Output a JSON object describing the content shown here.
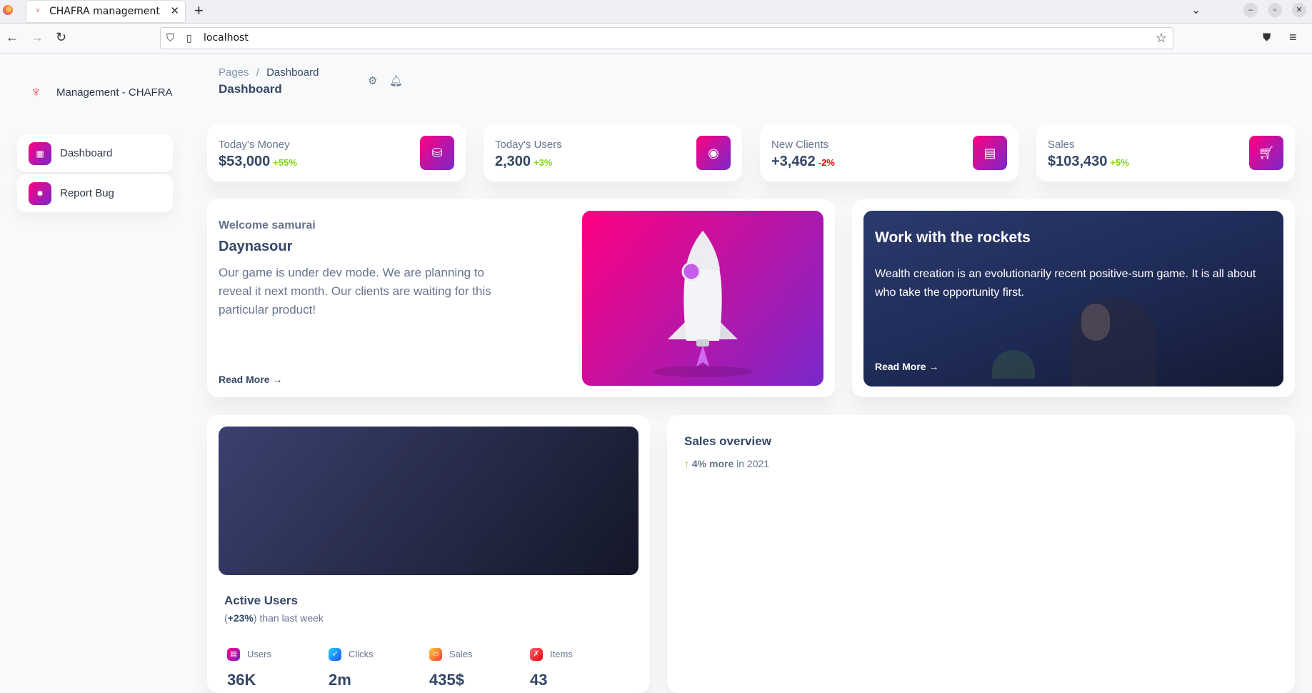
{
  "browser": {
    "tab_title": "CHAFRA management",
    "url": "localhost"
  },
  "sidebar": {
    "brand": "Management - CHAFRA",
    "items": [
      {
        "label": "Dashboard",
        "icon": "shop-icon"
      },
      {
        "label": "Report Bug",
        "icon": "bug-icon"
      }
    ]
  },
  "header": {
    "breadcrumb_root": "Pages",
    "breadcrumb_sep": "/",
    "breadcrumb_current": "Dashboard",
    "title": "Dashboard"
  },
  "stats": [
    {
      "label": "Today's Money",
      "value": "$53,000",
      "change": "+55%",
      "trend": "up",
      "icon": "money-icon"
    },
    {
      "label": "Today's Users",
      "value": "2,300",
      "change": "+3%",
      "trend": "up",
      "icon": "globe-icon"
    },
    {
      "label": "New Clients",
      "value": "+3,462",
      "change": "-2%",
      "trend": "down",
      "icon": "document-icon"
    },
    {
      "label": "Sales",
      "value": "$103,430",
      "change": "+5%",
      "trend": "up",
      "icon": "cart-icon"
    }
  ],
  "welcome": {
    "subtitle": "Welcome samurai",
    "title": "Daynasour",
    "text": "Our game is under dev mode. We are planning to reveal it next month. Our clients are waiting for this particular product!",
    "link": "Read More"
  },
  "rockets": {
    "title": "Work with the rockets",
    "text": "Wealth creation is an evolutionarily recent positive-sum game. It is all about who take the opportunity first.",
    "link": "Read More"
  },
  "active_users": {
    "title": "Active Users",
    "change": "+23%",
    "suffix": "than last week",
    "metrics": [
      {
        "label": "Users",
        "value": "36K",
        "color": "#cb0c9f"
      },
      {
        "label": "Clicks",
        "value": "2m",
        "color": "#17c1e8"
      },
      {
        "label": "Sales",
        "value": "435$",
        "color": "#f53939"
      },
      {
        "label": "Items",
        "value": "43",
        "color": "#ea0606"
      }
    ]
  },
  "sales_overview": {
    "title": "Sales overview",
    "change": "4% more",
    "period": "in 2021"
  },
  "colors": {
    "accent_gradient_start": "#7928ca",
    "accent_gradient_end": "#ff0080",
    "positive": "#82d616",
    "negative": "#ea0606",
    "text_dark": "#344767",
    "text_muted": "#67748e"
  }
}
